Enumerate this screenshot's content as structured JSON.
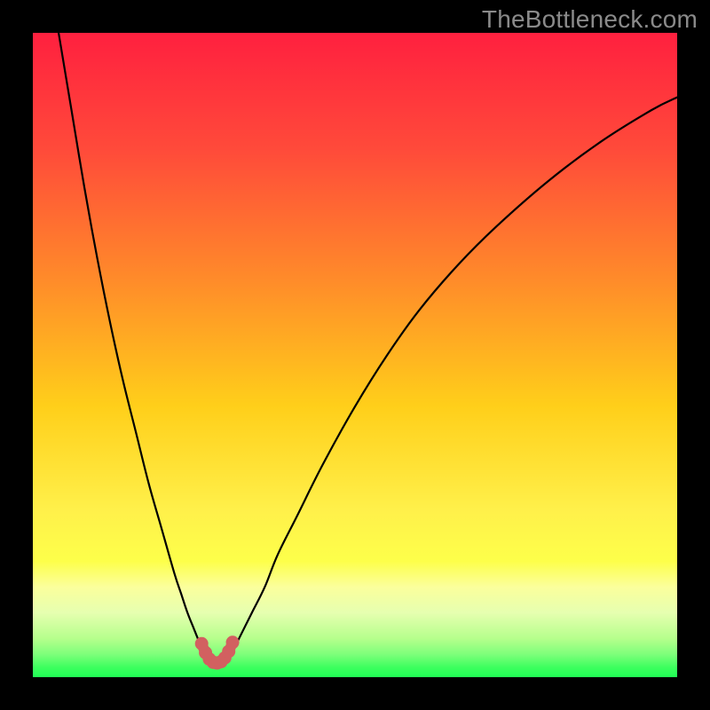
{
  "watermark": "TheBottleneck.com",
  "colors": {
    "frame": "#000000",
    "gradient_top": "#ff203f",
    "gradient_mid1": "#ff7f2a",
    "gradient_mid2": "#ffe000",
    "gradient_mid3": "#fff966",
    "gradient_band_yellow": "#fdff4a",
    "gradient_band_pale": "#d9ffa0",
    "gradient_bottom": "#2aff5a",
    "curve_stroke": "#000000",
    "marker_stroke": "#d26060",
    "marker_fill": "#d26060"
  },
  "chart_data": {
    "type": "line",
    "title": "",
    "xlabel": "",
    "ylabel": "",
    "xlim": [
      0,
      100
    ],
    "ylim": [
      0,
      100
    ],
    "grid": false,
    "series": [
      {
        "name": "left-branch",
        "x": [
          4,
          6,
          8,
          10,
          12,
          14,
          16,
          18,
          20,
          22,
          23,
          24,
          25,
          26,
          26.8
        ],
        "y": [
          100,
          88,
          76,
          65,
          55,
          46,
          38,
          30,
          23,
          16,
          13,
          10,
          7.5,
          5,
          3
        ]
      },
      {
        "name": "right-branch",
        "x": [
          30.5,
          32,
          34,
          36,
          38,
          41,
          45,
          50,
          55,
          60,
          66,
          72,
          80,
          88,
          96,
          100
        ],
        "y": [
          3,
          6,
          10,
          14,
          19,
          25,
          33,
          42,
          50,
          57,
          64,
          70,
          77,
          83,
          88,
          90
        ]
      },
      {
        "name": "markers",
        "x": [
          26.2,
          26.8,
          27.4,
          28.0,
          28.6,
          29.2,
          29.8,
          30.4,
          31.0
        ],
        "y": [
          5.2,
          3.8,
          2.8,
          2.3,
          2.2,
          2.4,
          3.0,
          4.0,
          5.4
        ]
      }
    ]
  }
}
